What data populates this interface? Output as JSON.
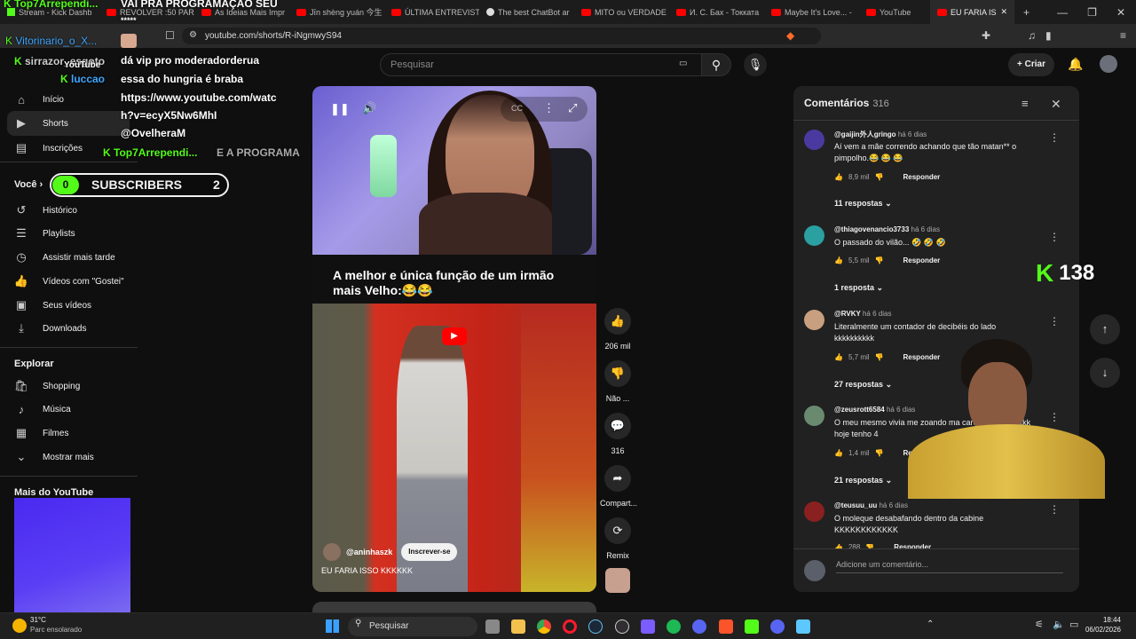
{
  "browser": {
    "tabs": [
      {
        "label": "Stream - Kick Dashb",
        "icon": "kick-icon"
      },
      {
        "label": "REVOLVER :50 PARA",
        "icon": "youtube-icon"
      },
      {
        "label": "As Ideias Mais Impr",
        "icon": "youtube-icon"
      },
      {
        "label": "Jīn shèng yuán 今生",
        "icon": "youtube-icon"
      },
      {
        "label": "ÚLTIMA ENTREVISTA",
        "icon": "youtube-icon"
      },
      {
        "label": "The best ChatBot ar",
        "icon": "chatbot-icon"
      },
      {
        "label": "MITO ou VERDADE",
        "icon": "youtube-icon"
      },
      {
        "label": "И. С. Бах - Токката",
        "icon": "youtube-icon"
      },
      {
        "label": "Maybe It's Love... -",
        "icon": "youtube-icon"
      },
      {
        "label": "YouTube",
        "icon": "youtube-icon"
      }
    ],
    "active_tab": "EU FARIA IS",
    "url": "youtube.com/shorts/R-iNgmwyS94"
  },
  "header": {
    "search_placeholder": "Pesquisar",
    "create_label": "Criar"
  },
  "sidebar": {
    "top": [
      {
        "label": "Início",
        "icon": "home-icon"
      },
      {
        "label": "Shorts",
        "icon": "shorts-icon"
      },
      {
        "label": "Inscrições",
        "icon": "subscriptions-icon"
      }
    ],
    "you_heading": "Você",
    "you": [
      {
        "label": "Histórico",
        "icon": "history-icon"
      },
      {
        "label": "Playlists",
        "icon": "playlists-icon"
      },
      {
        "label": "Assistir mais tarde",
        "icon": "clock-icon"
      },
      {
        "label": "Vídeos com \"Gostei\"",
        "icon": "like-icon"
      },
      {
        "label": "Seus vídeos",
        "icon": "video-icon"
      },
      {
        "label": "Downloads",
        "icon": "download-icon"
      }
    ],
    "explore_heading": "Explorar",
    "explore": [
      {
        "label": "Shopping",
        "icon": "shopping-icon"
      },
      {
        "label": "Música",
        "icon": "music-icon"
      },
      {
        "label": "Filmes",
        "icon": "film-icon"
      },
      {
        "label": "Mostrar mais",
        "icon": "chevron-down-icon"
      }
    ],
    "more_heading": "Mais do YouTube"
  },
  "short": {
    "caption": "A melhor e única função de um irmão mais Velho:😂😂",
    "channel": "@aninhaszk",
    "subscribe_label": "Inscrever-se",
    "title": "EU FARIA ISSO KKKKKK"
  },
  "actions": {
    "like_count": "206 mil",
    "dislike_label": "Não ...",
    "comments_count": "316",
    "share_label": "Compart...",
    "remix_label": "Remix"
  },
  "comments": {
    "title": "Comentários",
    "count": "316",
    "reply_label": "Responder",
    "add_placeholder": "Adicione um comentário...",
    "items": [
      {
        "user": "@gaijin外人gringo",
        "age": "há 6 dias",
        "text": "Aí vem a mãe correndo achando que tão matan** o pimpolho.😂 😂 😂",
        "likes": "8,9 mil",
        "replies": "11 respostas",
        "avatar_color": "#4a3aa0"
      },
      {
        "user": "@thiagovenancio3733",
        "age": "há 6 dias",
        "text": "O passado do vilão... 🤣 🤣 🤣",
        "likes": "5,5 mil",
        "replies": "1 resposta",
        "avatar_color": "#2aa0a0"
      },
      {
        "user": "@RVKY",
        "age": "há 6 dias",
        "text": "Literalmente um contador de decibéis do lado kkkkkkkkkk",
        "likes": "5,7 mil",
        "replies": "27 respostas",
        "avatar_color": "#c8a080"
      },
      {
        "user": "@zeusrott6584",
        "age": "há 6 dias",
        "text": "O meu mesmo vivia me zoando ma careca safado kkkk hoje tenho 4",
        "likes": "1,4 mil",
        "replies": "21 respostas",
        "avatar_color": "#6a8a70"
      },
      {
        "user": "@teusuu_uu",
        "age": "há 6 dias",
        "text": "O moleque desabafando dentro da cabine KKKKKKKKKKKK",
        "likes": "288",
        "replies": "",
        "avatar_color": "#8a2020"
      }
    ]
  },
  "stream_overlay": {
    "top_user": "Top7Arrependi...",
    "top_message": "VAI PRA PROGRAMAÇÃO SEU",
    "stars": "*****",
    "user2": "Vitorinario_o_X...",
    "user3": "sirrazor_esgoto",
    "youtube_word": "YouTube",
    "user4": "luccao",
    "chat_lines": [
      "dá vip pro moderadorderua",
      "essa do hungria é braba",
      "https://www.youtube.com/watc",
      "h?v=ecyX5Nw6MhI",
      "@OvelheraM"
    ],
    "bottom_user": "Top7Arrependi...",
    "bottom_message": "E A PROGRAMA",
    "subs_start": "0",
    "subs_label": "SUBSCRIBERS",
    "subs_end": "2",
    "viewers": "138",
    "kick_color": "#53fc18"
  },
  "taskbar": {
    "temp": "31°C",
    "weather": "Parc ensolarado",
    "search": "Pesquisar",
    "time": "18:44",
    "date": "06/02/2026"
  }
}
